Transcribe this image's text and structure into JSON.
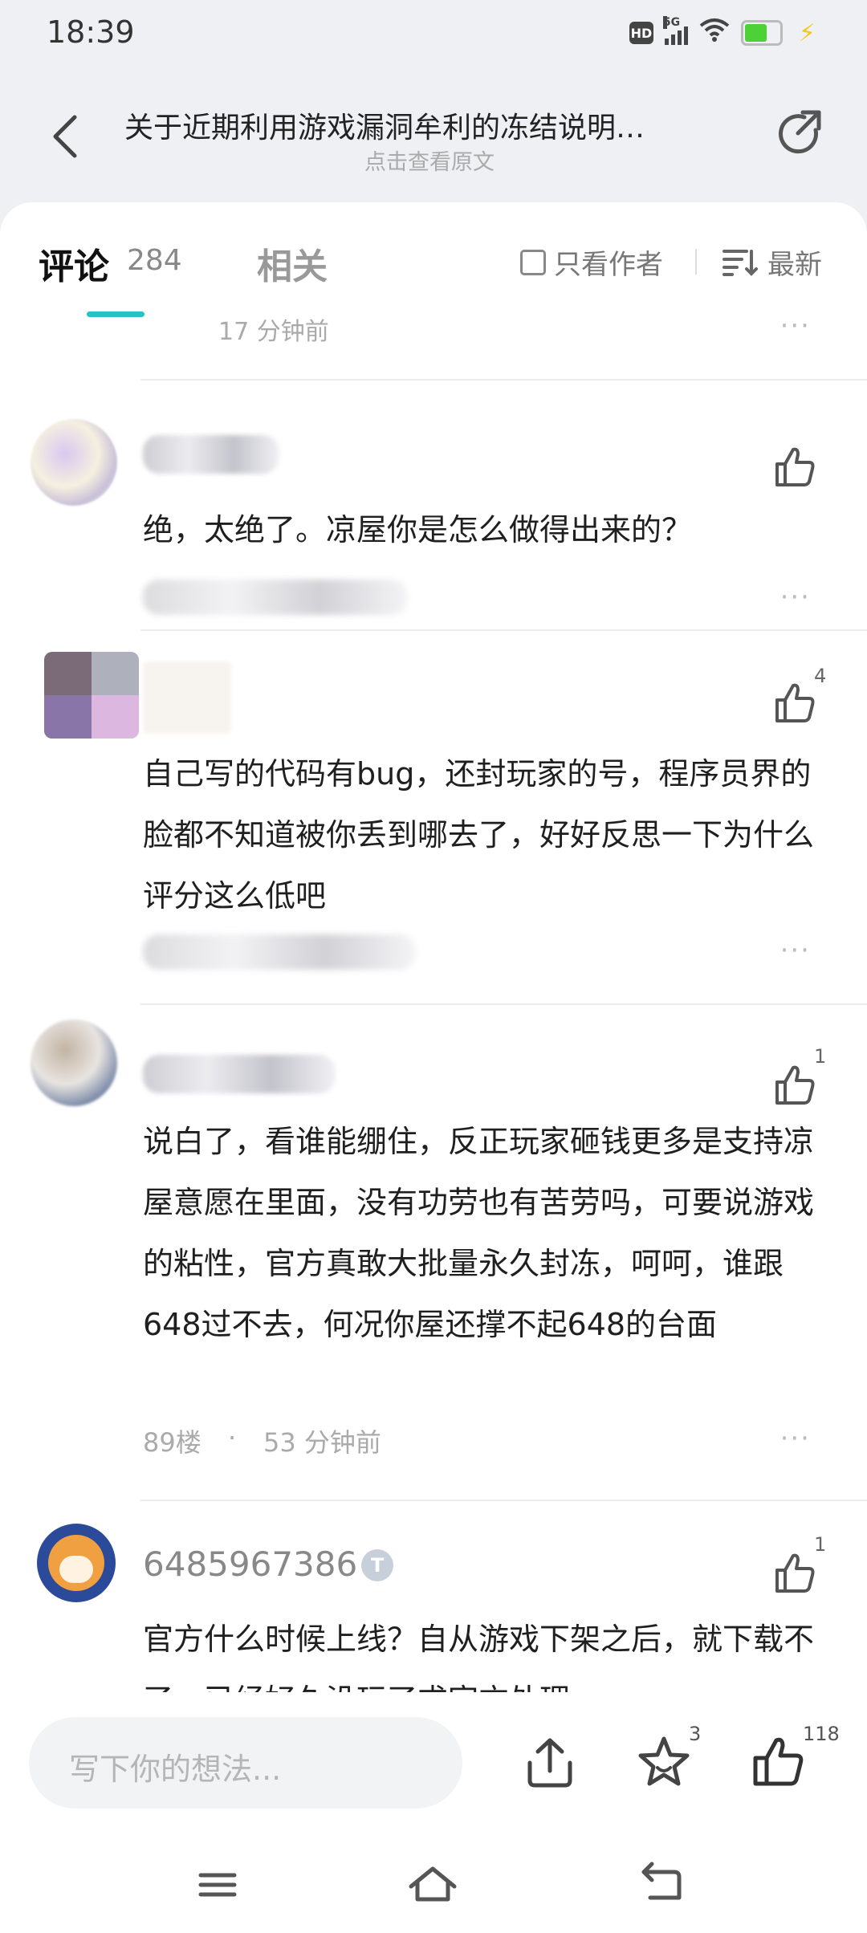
{
  "status_bar": {
    "time": "18:39",
    "network": "5G"
  },
  "header": {
    "title": "关于近期利用游戏漏洞牟利的冻结说明…",
    "subtitle": "点击查看原文"
  },
  "tabs": {
    "comments_label": "评论",
    "comments_count": "284",
    "related_label": "相关",
    "author_only_label": "只看作者",
    "sort_label": "最新"
  },
  "previous_comment": {
    "time": "17 分钟前"
  },
  "comments": [
    {
      "text": "绝，太绝了。凉屋你是怎么做得出来的？",
      "likes": ""
    },
    {
      "text": "自己写的代码有bug，还封玩家的号，程序员界的脸都不知道被你丢到哪去了，好好反思一下为什么评分这么低吧",
      "likes": "4"
    },
    {
      "text": "说白了，看谁能绷住，反正玩家砸钱更多是支持凉屋意愿在里面，没有功劳也有苦劳吗，可要说游戏的粘性，官方真敢大批量永久封冻，呵呵，谁跟648过不去，何况你屋还撑不起648的台面",
      "likes": "1",
      "floor": "89楼",
      "dot": "·",
      "time": "53 分钟前"
    },
    {
      "username": "6485967386",
      "badge": "T",
      "text": "官方什么时候上线？自从游戏下架之后，就下载不了，已经好久没玩了求官方处理",
      "likes": "1"
    }
  ],
  "more_label": "···",
  "bottom_bar": {
    "input_placeholder": "写下你的想法...",
    "favorite_count": "3",
    "like_count": "118"
  }
}
